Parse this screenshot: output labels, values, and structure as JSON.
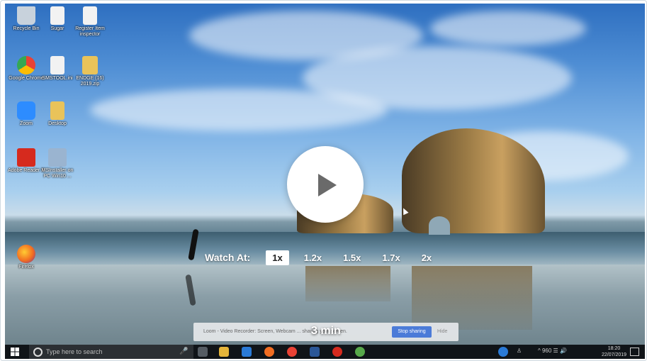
{
  "desktop": {
    "icons": [
      {
        "label": "Recycle Bin",
        "color": "#c8d2dc"
      },
      {
        "label": "Sugar",
        "color": "#f2f2f2"
      },
      {
        "label": "Register Item inspector",
        "color": "#f2f2f2"
      },
      {
        "label": "Google Chrome",
        "color": "#e94235"
      },
      {
        "label": "SMSTOOL.ini",
        "color": "#f2f2f2"
      },
      {
        "label": "ENDGE (16) 2019.zip",
        "color": "#e9c35a"
      },
      {
        "label": "Zoom",
        "color": "#2d8cff"
      },
      {
        "label": "Desktop",
        "color": "#e9c35a"
      },
      {
        "label": "Adobe Reader X",
        "color": "#d62a1e"
      },
      {
        "label": "MSInstaller on PC Win10 ...",
        "color": "#9ab4d0"
      },
      {
        "label": "Firefox",
        "color": "#f26d21"
      }
    ]
  },
  "player": {
    "play_label": "play",
    "watch_at_label": "Watch At:",
    "speeds": [
      "1x",
      "1.2x",
      "1.5x",
      "1.7x",
      "2x"
    ],
    "active_speed": "1x",
    "duration": "3 min"
  },
  "loom": {
    "text": "Loom - Video Recorder: Screen, Webcam ... sharing your screen.",
    "stop_label": "Stop sharing",
    "hide_label": "Hide"
  },
  "taskbar": {
    "search_placeholder": "Type here to search",
    "apps": [
      {
        "name": "task-view",
        "color": "#555c63"
      },
      {
        "name": "file-explorer",
        "color": "#e5b53a"
      },
      {
        "name": "store",
        "color": "#2a7ad6"
      },
      {
        "name": "firefox",
        "color": "#f26d21"
      },
      {
        "name": "chrome",
        "color": "#e94235"
      },
      {
        "name": "word",
        "color": "#2b5797"
      },
      {
        "name": "acrobat",
        "color": "#d62a1e"
      },
      {
        "name": "app-misc",
        "color": "#57a84a"
      }
    ],
    "tray_text": "^ 960 ☰ 🔊",
    "time": "18:20",
    "date": "22/07/2019"
  },
  "colors": {
    "accent": "#4b7bd8",
    "taskbar": "#101418"
  }
}
